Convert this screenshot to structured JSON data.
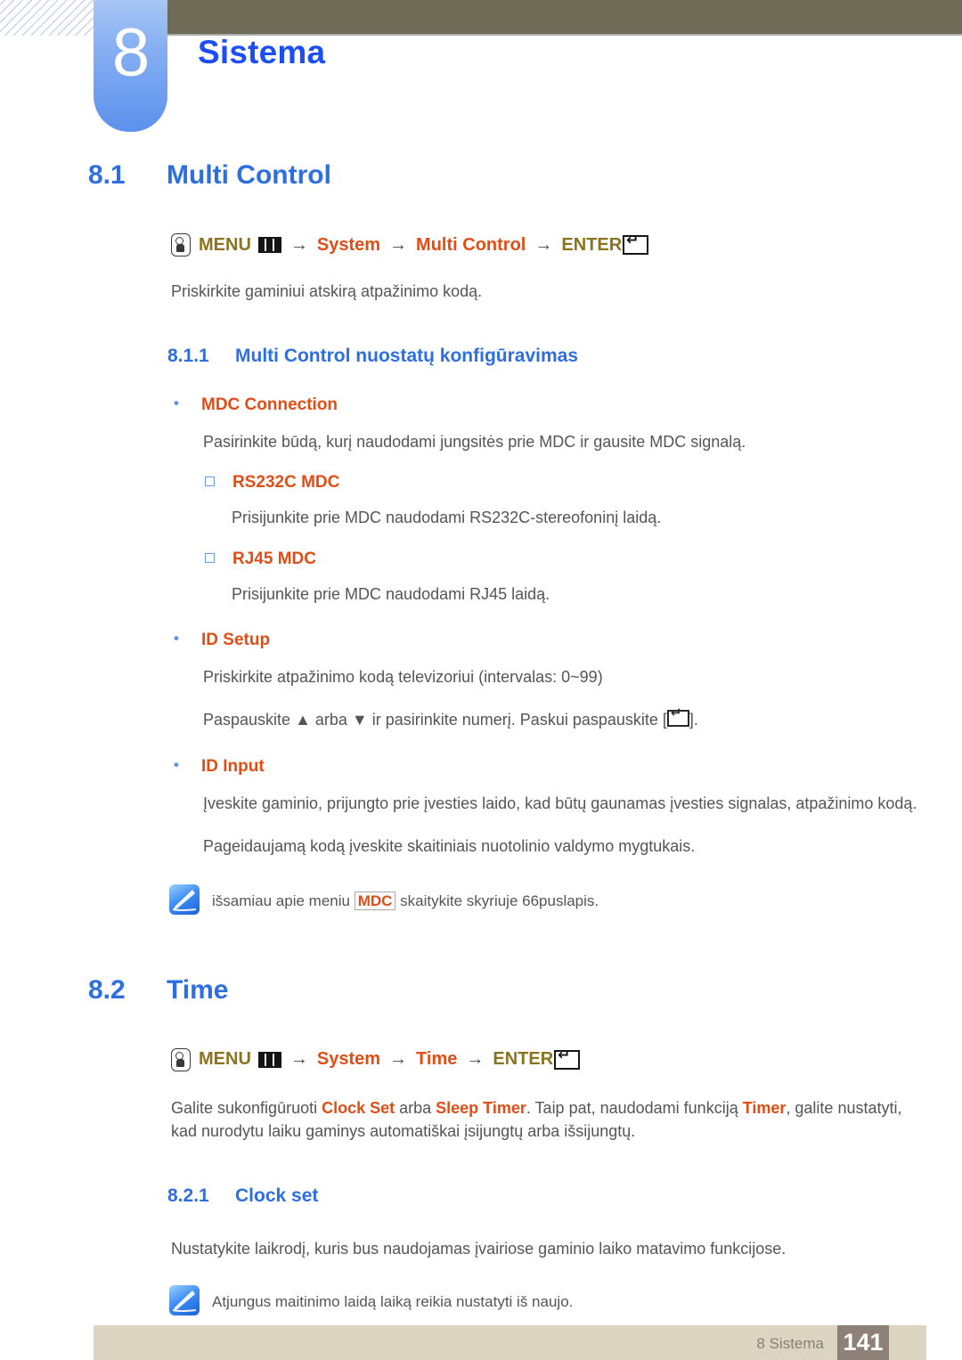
{
  "header": {
    "chapter_number": "8",
    "chapter_title": "Sistema"
  },
  "sections": {
    "multi_control": {
      "number": "8.1",
      "title": "Multi Control",
      "menu_path": {
        "press_icon": "press-button-icon",
        "menu_label": "MENU",
        "menu_icon": "menu-bars-icon",
        "arrow": "→",
        "item1": "System",
        "item2": "Multi Control",
        "enter_label": "ENTER",
        "enter_icon": "enter-key-icon"
      },
      "intro": "Priskirkite gaminiui atskirą atpažinimo kodą.",
      "sub": {
        "number": "8.1.1",
        "title": "Multi Control nuostatų konfigūravimas"
      },
      "bullets": [
        {
          "label": "MDC Connection",
          "desc": "Pasirinkite būdą, kurį naudodami jungsitės prie MDC ir gausite MDC signalą.",
          "children": [
            {
              "label": "RS232C MDC",
              "desc": "Prisijunkite prie MDC naudodami RS232C-stereofoninį laidą."
            },
            {
              "label": "RJ45 MDC",
              "desc": "Prisijunkite prie MDC naudodami RJ45 laidą."
            }
          ]
        },
        {
          "label": "ID Setup",
          "desc": "Priskirkite atpažinimo kodą televizoriui (intervalas: 0~99)",
          "desc2_a": "Paspauskite ",
          "desc2_up": "▲",
          "desc2_b": " arba ",
          "desc2_down": "▼",
          "desc2_c": " ir pasirinkite numerį. Paskui paspauskite [",
          "desc2_d": "]."
        },
        {
          "label": "ID Input",
          "desc": "Įveskite gaminio, prijungto prie įvesties laido, kad būtų gaunamas įvesties signalas, atpažinimo kodą.",
          "desc2": "Pageidaujamą kodą įveskite skaitiniais nuotolinio valdymo mygtukais."
        }
      ],
      "note": {
        "icon": "note-pencil-icon",
        "text_a": "išsamiau apie meniu ",
        "highlight": "MDC",
        "text_b": " skaitykite skyriuje 66puslapis."
      }
    },
    "time": {
      "number": "8.2",
      "title": "Time",
      "menu_path": {
        "press_icon": "press-button-icon",
        "menu_label": "MENU",
        "menu_icon": "menu-bars-icon",
        "arrow": "→",
        "item1": "System",
        "item2": "Time",
        "enter_label": "ENTER",
        "enter_icon": "enter-key-icon"
      },
      "paragraph": {
        "a": "Galite sukonfigūruoti ",
        "hl1": "Clock Set",
        "b": " arba ",
        "hl2": "Sleep Timer",
        "c": ". Taip pat, naudodami funkciją ",
        "hl3": "Timer",
        "d": ", galite nustatyti, kad nurodytu laiku gaminys automatiškai įsijungtų arba išsijungtų."
      },
      "sub": {
        "number": "8.2.1",
        "title": "Clock set"
      },
      "sub_desc": "Nustatykite laikrodį, kuris bus naudojamas įvairiose gaminio laiko matavimo funkcijose.",
      "note": {
        "icon": "note-pencil-icon",
        "text": "Atjungus maitinimo laidą laiką reikia nustatyti iš naujo."
      }
    }
  },
  "footer": {
    "label": "8 Sistema",
    "page_number": "141"
  },
  "colors": {
    "heading_blue": "#2e6fe0",
    "title_blue": "#1b4ef5",
    "accent_orange": "#e04e16",
    "menu_olive": "#8a7420",
    "header_bar": "#6d6b56",
    "footer_bar": "#dbd5c2",
    "page_box": "#8e8177"
  }
}
